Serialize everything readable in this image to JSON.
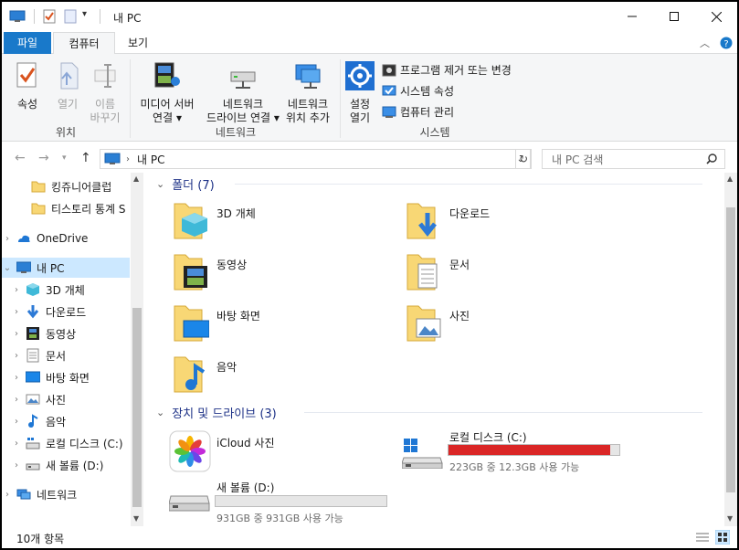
{
  "window": {
    "title": "내 PC"
  },
  "tabs": {
    "file": "파일",
    "computer": "컴퓨터",
    "view": "보기"
  },
  "ribbon": {
    "location": {
      "properties": "속성",
      "open": "열기",
      "rename_1": "이름",
      "rename_2": "바꾸기",
      "group": "위치"
    },
    "network": {
      "media_1": "미디어 서버",
      "media_2": "연결",
      "map_1": "네트워크",
      "map_2": "드라이브 연결",
      "add_1": "네트워크",
      "add_2": "위치 추가",
      "group": "네트워크"
    },
    "system": {
      "settings_1": "설정",
      "settings_2": "열기",
      "uninstall": "프로그램 제거 또는 변경",
      "sysprops": "시스템 속성",
      "manage": "컴퓨터 관리",
      "group": "시스템"
    }
  },
  "address": {
    "path": "내 PC",
    "search_placeholder": "내 PC 검색"
  },
  "navpane": {
    "items": [
      {
        "label": "킹쥬니어클럽",
        "icon": "folder-icon"
      },
      {
        "label": "티스토리 통계 S",
        "icon": "folder-icon"
      },
      {
        "label": "OneDrive",
        "icon": "onedrive-icon"
      },
      {
        "label": "내 PC",
        "icon": "this-pc-icon"
      },
      {
        "label": "3D 개체",
        "icon": "3d-objects-icon"
      },
      {
        "label": "다운로드",
        "icon": "downloads-icon"
      },
      {
        "label": "동영상",
        "icon": "videos-icon"
      },
      {
        "label": "문서",
        "icon": "documents-icon"
      },
      {
        "label": "바탕 화면",
        "icon": "desktop-icon"
      },
      {
        "label": "사진",
        "icon": "pictures-icon"
      },
      {
        "label": "음악",
        "icon": "music-icon"
      },
      {
        "label": "로컬 디스크 (C:)",
        "icon": "local-disk-icon"
      },
      {
        "label": "새 볼륨 (D:)",
        "icon": "drive-icon"
      },
      {
        "label": "네트워크",
        "icon": "network-icon"
      }
    ]
  },
  "content": {
    "folders_header": "폴더 (7)",
    "folders": {
      "objects3d": "3D 개체",
      "downloads": "다운로드",
      "videos": "동영상",
      "documents": "문서",
      "desktop": "바탕 화면",
      "pictures": "사진",
      "music": "음악"
    },
    "devices_header": "장치 및 드라이브 (3)",
    "devices": {
      "icloud": "iCloud 사진",
      "c_name": "로컬 디스크 (C:)",
      "c_info": "223GB 중 12.3GB 사용 가능",
      "c_used_fraction": 0.945,
      "d_name": "새 볼륨 (D:)",
      "d_info": "931GB 중 931GB 사용 가능",
      "d_used_fraction": 0.0
    }
  },
  "status": {
    "item_count": "10개 항목"
  },
  "colors": {
    "accent": "#1979ca",
    "selected": "#cce8ff",
    "drive_full": "#da2626",
    "header": "#1e3287"
  }
}
